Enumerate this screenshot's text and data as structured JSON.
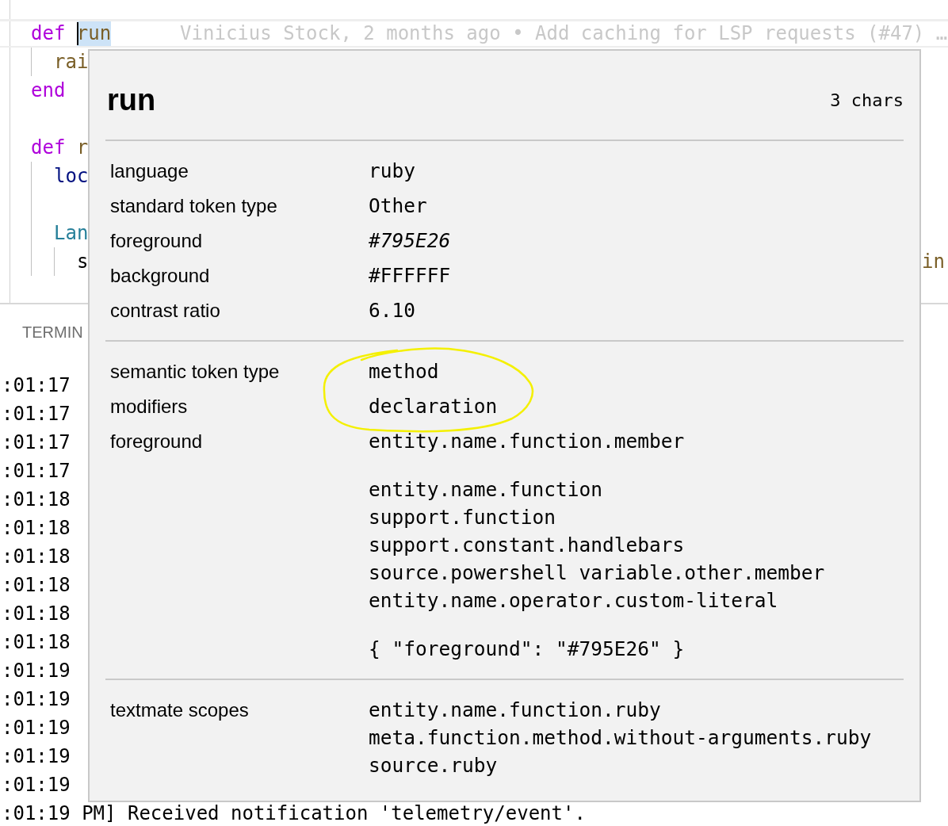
{
  "editor": {
    "lines": [
      {
        "kind": "code",
        "segments": [
          {
            "text": "def",
            "kind": "keyword"
          },
          {
            "text": "run",
            "kind": "function",
            "selected": true
          }
        ],
        "current": true,
        "blame": "Vinicius Stock, 2 months ago • Add caching for LSP requests (#47) …",
        "children": [
          {
            "kind": "code",
            "segments": [
              {
                "text": "rai",
                "kind": "function"
              }
            ]
          }
        ]
      },
      {
        "kind": "code",
        "segments": [
          {
            "text": "end",
            "kind": "keyword"
          }
        ]
      },
      {
        "kind": "blank"
      },
      {
        "kind": "code",
        "segments": [
          {
            "text": "def",
            "kind": "keyword"
          },
          {
            "text": "r",
            "kind": "function"
          }
        ],
        "children": [
          {
            "kind": "code",
            "segments": [
              {
                "text": "loc",
                "kind": "variable"
              }
            ]
          },
          {
            "kind": "blank"
          },
          {
            "kind": "code",
            "segments": [
              {
                "text": "Lan",
                "kind": "type"
              }
            ],
            "children": [
              {
                "kind": "code",
                "segments": [
                  {
                    "text": "s",
                    "kind": "plain"
                  }
                ],
                "tail": {
                  "text": "in",
                  "kind": "function"
                }
              }
            ]
          }
        ]
      }
    ]
  },
  "terminal": {
    "tab": "TERMIN",
    "lines": [
      ":01:17",
      ":01:17",
      ":01:17",
      ":01:17",
      ":01:18",
      ":01:18",
      ":01:18",
      ":01:18",
      ":01:18",
      ":01:18",
      ":01:19",
      ":01:19",
      ":01:19",
      ":01:19",
      ":01:19",
      ":01:19 PM] Received notification 'telemetry/event'."
    ]
  },
  "hover": {
    "title": "run",
    "length": "3 chars",
    "sections": [
      {
        "rows": [
          {
            "label": "language",
            "values": [
              [
                "ruby"
              ]
            ],
            "italic": false
          },
          {
            "label": "standard token type",
            "values": [
              [
                "Other"
              ]
            ],
            "italic": false
          },
          {
            "label": "foreground",
            "values": [
              [
                "#795E26"
              ]
            ],
            "italic": true
          },
          {
            "label": "background",
            "values": [
              [
                "#FFFFFF"
              ]
            ],
            "italic": false
          },
          {
            "label": "contrast ratio",
            "values": [
              [
                "6.10"
              ]
            ],
            "italic": false
          }
        ]
      },
      {
        "rows": [
          {
            "label": "semantic token type",
            "values": [
              [
                "method"
              ]
            ],
            "italic": false
          },
          {
            "label": "modifiers",
            "values": [
              [
                "declaration"
              ]
            ],
            "italic": false
          },
          {
            "label": "foreground",
            "values": [
              [
                "entity.name.function.member"
              ],
              [
                "entity.name.function",
                "support.function",
                "support.constant.handlebars",
                "source.powershell variable.other.member",
                "entity.name.operator.custom-literal"
              ],
              [
                "{ \"foreground\": \"#795E26\" }"
              ]
            ],
            "italic": false
          }
        ]
      },
      {
        "rows": [
          {
            "label": "textmate scopes",
            "values": [
              [
                "entity.name.function.ruby",
                "meta.function.method.without-arguments.ruby",
                "source.ruby"
              ]
            ],
            "italic": false
          }
        ]
      }
    ]
  }
}
